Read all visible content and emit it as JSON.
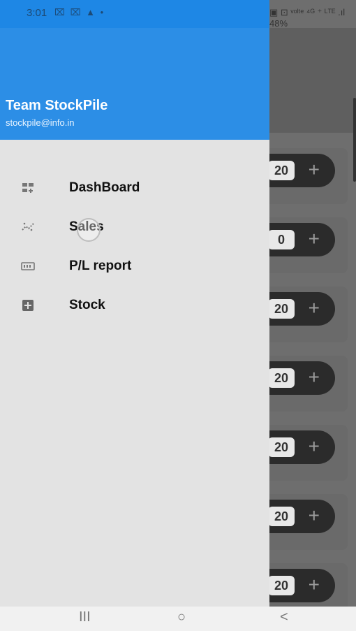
{
  "status_bar": {
    "time": "3:01",
    "left_icons": "⌧ ⌧ ▲ •",
    "right_icons": "▣ ⊡ ᵛᵒˡᵗᵉ ⁴ᴳ ⁺ ᴸᵀᴱ .ıl 48%"
  },
  "drawer": {
    "user_name": "Team StockPile",
    "user_email": "stockpile@info.in",
    "items": [
      {
        "label": "DashBoard",
        "icon": "dashboard-icon"
      },
      {
        "label": "Sales",
        "icon": "sales-icon"
      },
      {
        "label": "P/L report",
        "icon": "pl-report-icon"
      },
      {
        "label": "Stock",
        "icon": "stock-add-icon"
      }
    ]
  },
  "background_list": {
    "quantities": [
      "20",
      "0",
      "20",
      "20",
      "20",
      "20",
      "20"
    ],
    "plus_symbol": "+"
  },
  "nav": {
    "recent": "III",
    "home": "○",
    "back": "<"
  },
  "colors": {
    "header_blue": "#2c8ee6",
    "drawer_bg": "#e3e3e3",
    "dim_bg": "#6e6e6e"
  }
}
